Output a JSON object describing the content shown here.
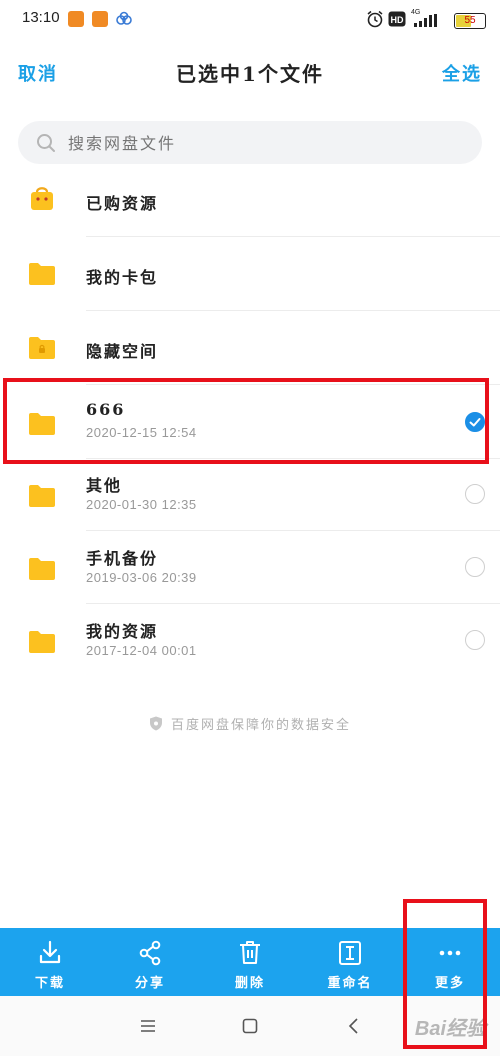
{
  "status_bar": {
    "time": "13:10",
    "app_icons": [
      "app-icon-orange-1",
      "app-icon-orange-2",
      "app-icon-blue"
    ],
    "right_icons": [
      "alarm-icon",
      "hd-icon",
      "4g-signal-icon"
    ],
    "network": "4G",
    "battery_percent": "55"
  },
  "header": {
    "cancel_label": "取消",
    "title": "已选中1个文件",
    "select_all_label": "全选"
  },
  "search": {
    "placeholder": "搜索网盘文件"
  },
  "files": [
    {
      "name": "已购资源",
      "date": "",
      "icon": "shopping-bag-icon",
      "selectable": false,
      "selected": false
    },
    {
      "name": "我的卡包",
      "date": "",
      "icon": "folder-icon",
      "selectable": false,
      "selected": false
    },
    {
      "name": "隐藏空间",
      "date": "",
      "icon": "locked-folder-icon",
      "selectable": false,
      "selected": false
    },
    {
      "name": "666",
      "date": "2020-12-15  12:54",
      "icon": "folder-icon",
      "selectable": true,
      "selected": true
    },
    {
      "name": "其他",
      "date": "2020-01-30  12:35",
      "icon": "folder-icon",
      "selectable": true,
      "selected": false
    },
    {
      "name": "手机备份",
      "date": "2019-03-06  20:39",
      "icon": "folder-icon",
      "selectable": true,
      "selected": false
    },
    {
      "name": "我的资源",
      "date": "2017-12-04  00:01",
      "icon": "folder-icon",
      "selectable": true,
      "selected": false
    }
  ],
  "security_note": "百度网盘保障你的数据安全",
  "toolbar": {
    "download_label": "下载",
    "share_label": "分享",
    "delete_label": "删除",
    "rename_label": "重命名",
    "more_label": "更多"
  },
  "watermark": "Bai经验",
  "colors": {
    "accent": "#1ca3ee",
    "folder": "#fcc11f",
    "highlight": "#e8101a"
  }
}
